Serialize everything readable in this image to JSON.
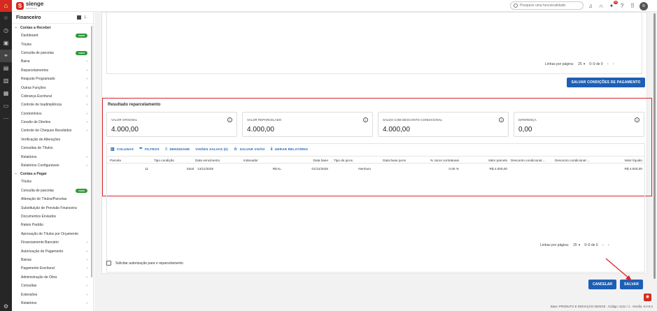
{
  "brand": {
    "name": "sienge",
    "sub": "SOFTPLAN"
  },
  "search": {
    "placeholder": "Pesquise uma funcionalidade"
  },
  "topbar": {
    "badge": "99",
    "avatar": "R"
  },
  "sidebar": {
    "title": "Financeiro",
    "sections": [
      {
        "label": "Contas a Receber",
        "items": [
          {
            "label": "Dashboard",
            "badge": "novo"
          },
          {
            "label": "Títulos"
          },
          {
            "label": "Consulta de parcelas",
            "badge": "novo"
          },
          {
            "label": "Baixa",
            "chevron": true
          },
          {
            "label": "Reparcelamentos",
            "chevron": true
          },
          {
            "label": "Reajuste Programado",
            "chevron": true
          },
          {
            "label": "Outras Funções",
            "chevron": true
          },
          {
            "label": "Cobrança Escritural",
            "chevron": true
          },
          {
            "label": "Controle de Inadimplência",
            "chevron": true
          },
          {
            "label": "Condomínios",
            "chevron": true
          },
          {
            "label": "Cessão de Direitos",
            "chevron": true
          },
          {
            "label": "Controle de Cheques Recebidos",
            "chevron": true
          },
          {
            "label": "Verificação de Alterações"
          },
          {
            "label": "Consultas de Títulos"
          },
          {
            "label": "Relatórios",
            "chevron": true
          },
          {
            "label": "Relatórios Configuráveis",
            "chevron": true
          }
        ]
      },
      {
        "label": "Contas a Pagar",
        "items": [
          {
            "label": "Títulos"
          },
          {
            "label": "Consulta de parcelas",
            "badge": "novo"
          },
          {
            "label": "Alteração de Títulos/Parcelas"
          },
          {
            "label": "Substituição de Previsão Financeira"
          },
          {
            "label": "Documentos Enviados"
          },
          {
            "label": "Rateio Padrão"
          },
          {
            "label": "Aprovação de Títulos por Orçamento"
          },
          {
            "label": "Financiamento Bancário",
            "chevron": true
          },
          {
            "label": "Autorização de Pagamento",
            "chevron": true
          },
          {
            "label": "Baixas",
            "chevron": true
          },
          {
            "label": "Pagamento Escritural",
            "chevron": true
          },
          {
            "label": "Administração de Obra",
            "chevron": true
          },
          {
            "label": "Consultas",
            "chevron": true
          },
          {
            "label": "Extensões",
            "chevron": true
          },
          {
            "label": "Relatórios",
            "chevron": true
          }
        ]
      }
    ]
  },
  "top_grid": {
    "rows_per_page_label": "Linhas por página:",
    "rows_per_page": "25",
    "range": "0–0 de 0"
  },
  "save_conditions_label": "SALVAR CONDIÇÕES DE PAGAMENTO",
  "result": {
    "title": "Resultado reparcelamento",
    "kpis": [
      {
        "label": "VALOR ORIGINAL",
        "value": "4.000,00"
      },
      {
        "label": "VALOR REPARCELADO",
        "value": "4.000,00"
      },
      {
        "label": "SALDO COM DESCONTO CONDICIONAL",
        "value": "4.000,00"
      },
      {
        "label": "DIFERENÇA",
        "value": "0,00"
      }
    ],
    "toolbar": {
      "columns": "COLUNAS",
      "filters": "FILTROS",
      "density": "DENSIDADE",
      "saved_views": "VISÕES SALVAS (0)",
      "save_view": "SALVAR VISÃO",
      "report": "GERAR RELATÓRIO"
    },
    "columns": [
      "Parcela",
      "Tipo condição",
      "Data vencimento",
      "Indexador",
      "Data base",
      "Tipo de juros",
      "Data base juros",
      "% Juros contratuais",
      "Valor parcela",
      "Desconto condicional ...",
      "Desconto condicional ...",
      "Valor líquido"
    ],
    "rows": [
      {
        "parcela": "11",
        "tipo": "Sinal",
        "vencimento": "13/11/2025",
        "indexador": "REAL",
        "data_base": "01/12/2025",
        "tipo_juros": "Nenhum",
        "data_base_juros": "",
        "juros": "0,00 %",
        "valor": "R$ 4.000,00",
        "desc1": "",
        "desc2": "",
        "liquido": "R$ 4.000,00"
      }
    ],
    "rows_per_page_label": "Linhas por página:",
    "rows_per_page": "25",
    "range": "0–0 de 0"
  },
  "authorization_label": "Solicitar autorização para o reparcelamento",
  "cancel_label": "CANCELAR",
  "save_label": "SALVAR",
  "footer": "Base: PRODUTO E INOVAÇÃO SIENGE . Código: 4211 / 1 . Versão: 9.0.9-2",
  "colors": {
    "brand_red": "#d52b1e",
    "primary_blue": "#1d5fb5",
    "badge_green": "#2e9a3a",
    "highlight_red": "#d8262d"
  }
}
